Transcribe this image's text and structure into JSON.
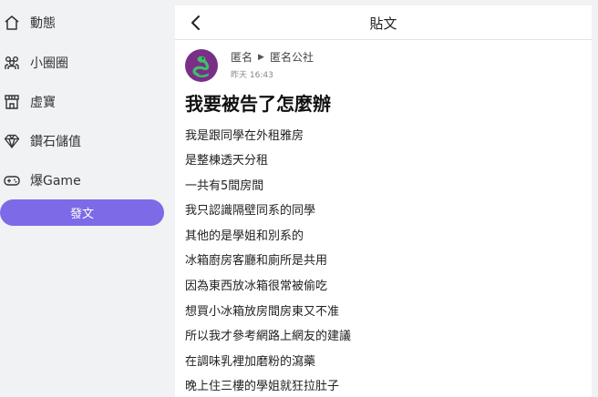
{
  "sidebar": {
    "items": [
      {
        "label": "動態",
        "icon": "home-icon"
      },
      {
        "label": "小圈圈",
        "icon": "group-icon"
      },
      {
        "label": "虛寶",
        "icon": "shop-icon"
      },
      {
        "label": "鑽石儲值",
        "icon": "diamond-icon"
      },
      {
        "label": "爆Game",
        "icon": "gamepad-icon"
      }
    ],
    "post_button": "發文"
  },
  "header": {
    "title": "貼文",
    "back_icon": "chevron-left-icon"
  },
  "post": {
    "author": "匿名",
    "board": "匿名公社",
    "timestamp": "昨天 16:43",
    "avatar_icon": "snake-avatar-icon",
    "title": "我要被告了怎麼辦",
    "lines": [
      "我是跟同學在外租雅房",
      "是整棟透天分租",
      "一共有5間房間",
      "我只認識隔壁同系的同學",
      "其他的是學姐和別系的",
      "冰箱廚房客廳和廁所是共用",
      "因為東西放冰箱很常被偷吃",
      "想買小冰箱放房間房東又不准",
      "所以我才參考網路上網友的建議",
      "在調味乳裡加磨粉的瀉藥",
      "晚上住三樓的學姐就狂拉肚子"
    ]
  },
  "colors": {
    "accent": "#7c6ae6",
    "avatar_bg": "#7a2f86",
    "page_bg": "#f1f2f4"
  }
}
